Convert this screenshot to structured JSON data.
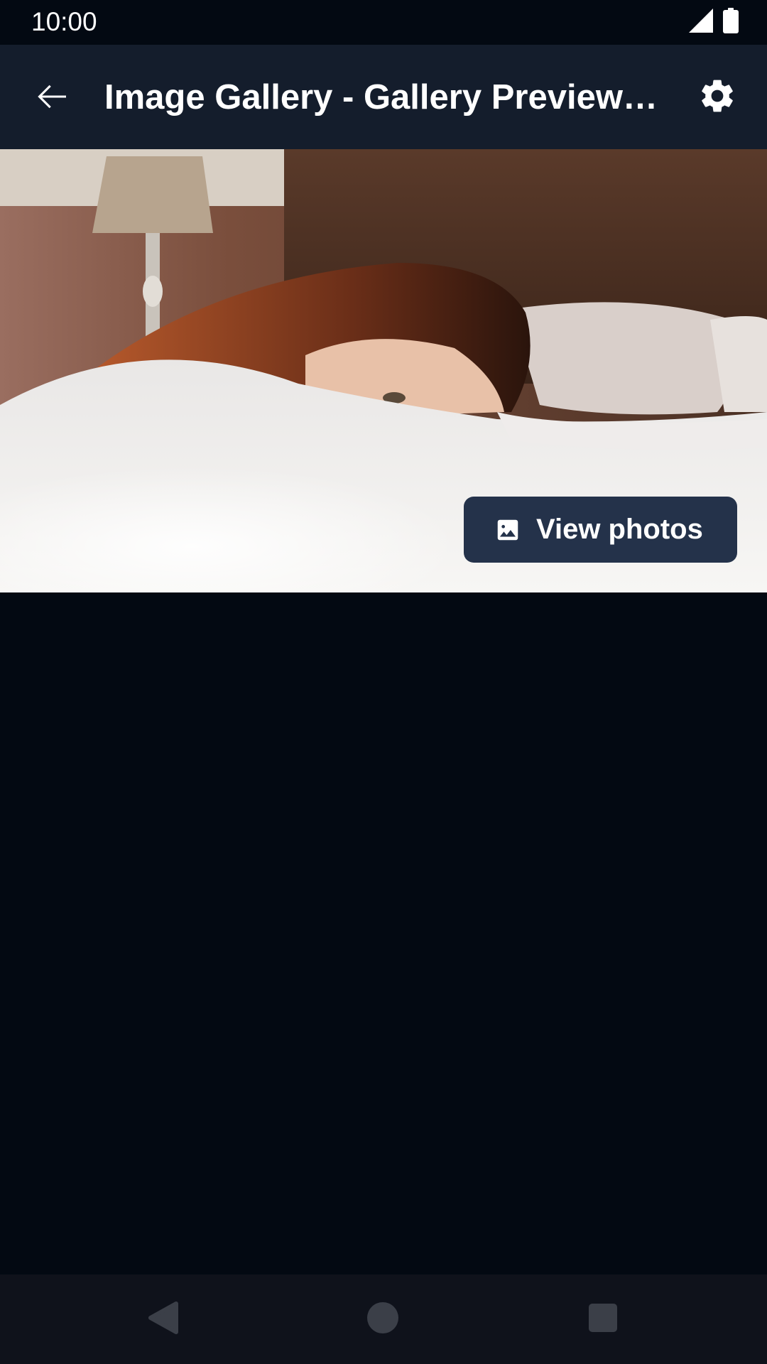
{
  "status_bar": {
    "time": "10:00",
    "icons": [
      "signal-icon",
      "battery-icon"
    ]
  },
  "app_bar": {
    "title": "Image Gallery - Gallery Preview with Button",
    "back_icon": "arrow-back-icon",
    "settings_icon": "gear-icon"
  },
  "preview": {
    "image_subject": "person-lying-on-bed-photo",
    "button": {
      "label": "View photos",
      "icon": "image-icon"
    }
  },
  "nav_bar": {
    "icons": [
      "nav-back-icon",
      "nav-home-icon",
      "nav-recents-icon"
    ]
  },
  "colors": {
    "background": "#030912",
    "app_bar": "#141d2c",
    "button": "#24324a",
    "nav_bar": "#0f121b",
    "text": "#ffffff"
  }
}
